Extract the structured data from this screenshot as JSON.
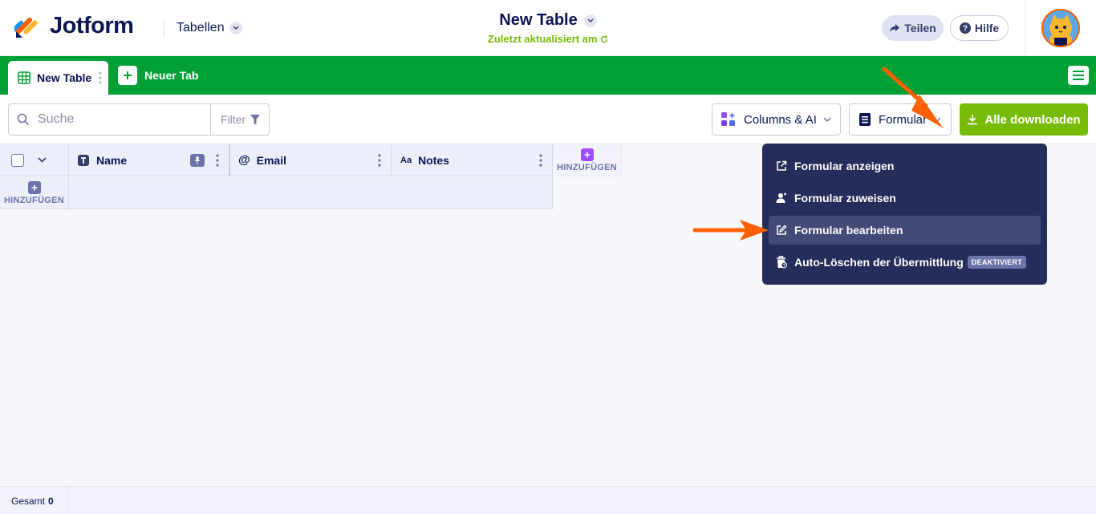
{
  "header": {
    "logo_text": "Jotform",
    "tables_label": "Tabellen",
    "title": "New Table",
    "subtitle": "Zuletzt aktualisiert am",
    "share_label": "Teilen",
    "help_label": "Hilfe"
  },
  "tabs": {
    "active_label": "New Table",
    "new_tab_label": "Neuer Tab"
  },
  "toolbar": {
    "search_placeholder": "Suche",
    "filter_label": "Filter",
    "columns_label": "Columns & AI",
    "form_label": "Formular",
    "download_label": "Alle downloaden"
  },
  "grid": {
    "columns": [
      {
        "label": "Name",
        "type_icon": "text-type-icon"
      },
      {
        "label": "Email",
        "type_icon": "at-icon"
      },
      {
        "label": "Notes",
        "type_icon": "aa-icon"
      }
    ],
    "add_column_label": "HINZUFÜGEN",
    "add_row_label": "HINZUFÜGEN"
  },
  "dropdown": {
    "items": [
      {
        "label": "Formular anzeigen",
        "icon": "external-link-icon"
      },
      {
        "label": "Formular zuweisen",
        "icon": "assign-user-icon"
      },
      {
        "label": "Formular bearbeiten",
        "icon": "edit-icon"
      },
      {
        "label": "Auto-Löschen der Übermittlung",
        "icon": "trash-clock-icon"
      }
    ],
    "badge": "DEAKTIVIERT"
  },
  "footer": {
    "total_label": "Gesamt",
    "total_value": "0"
  },
  "colors": {
    "brand_navy": "#0a1551",
    "tabbar_green": "#01a036",
    "download_green": "#78bb07",
    "dropdown_bg": "#252d5b",
    "arrow_orange": "#ff6100"
  }
}
